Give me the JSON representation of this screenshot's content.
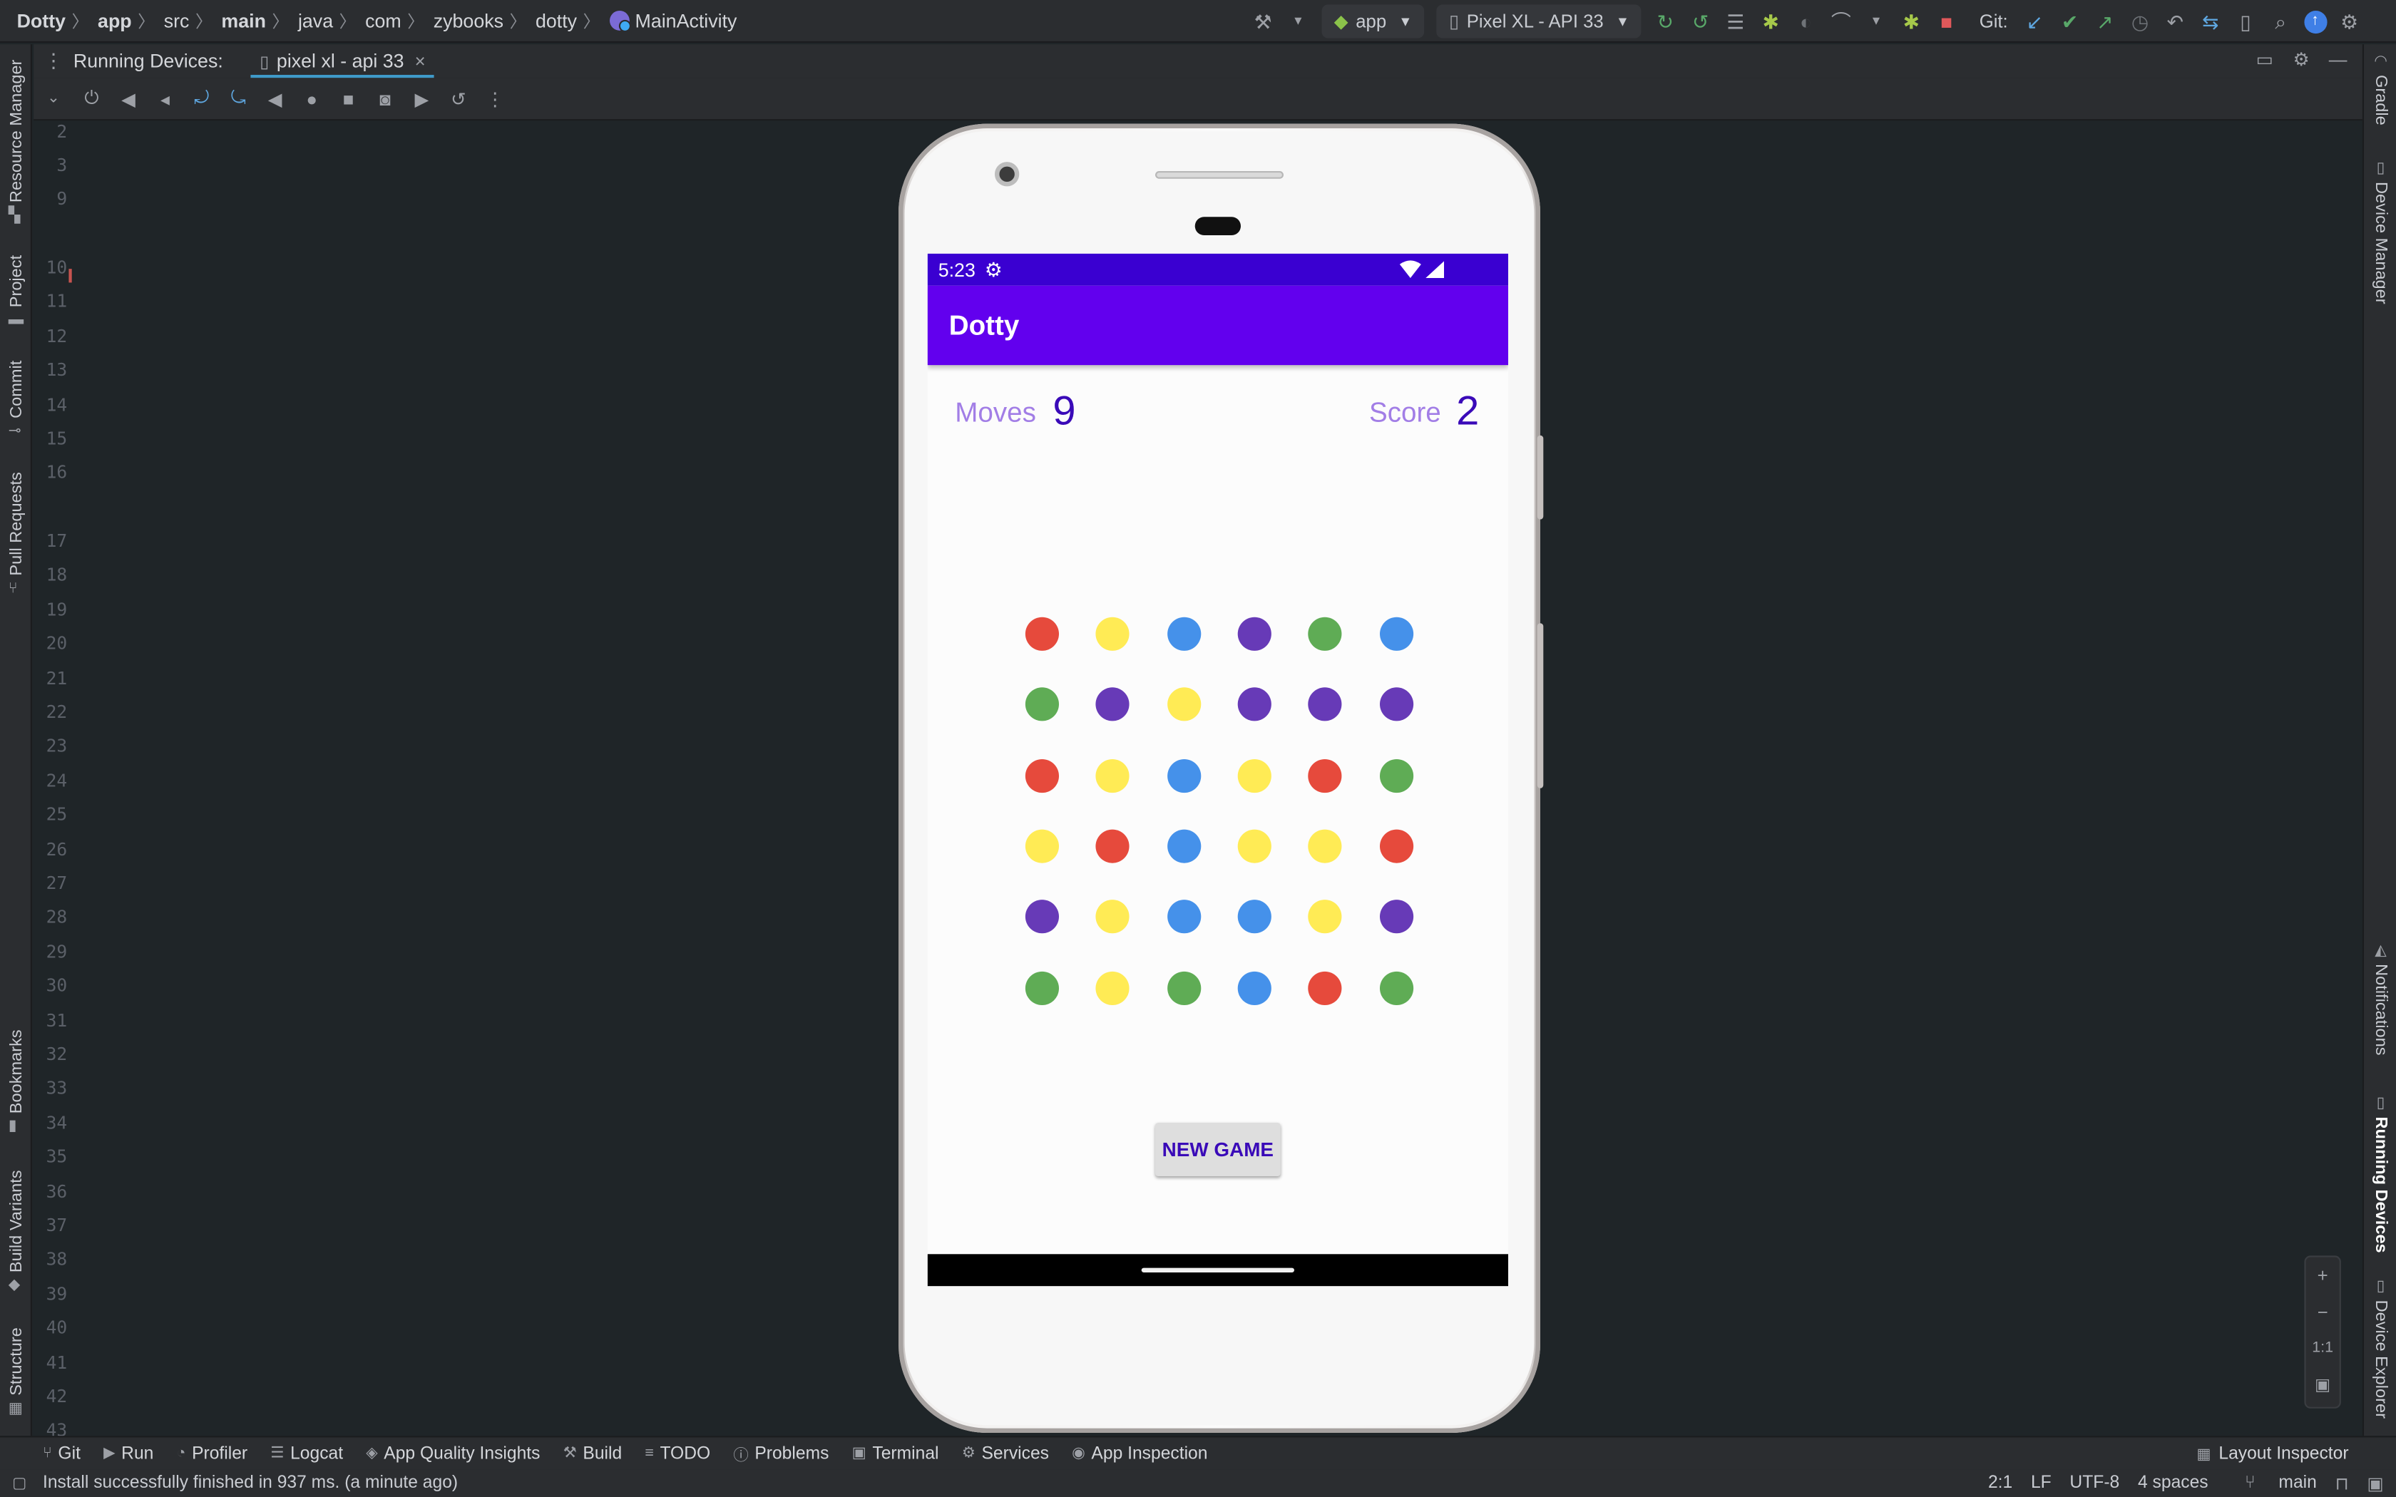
{
  "breadcrumbs": [
    {
      "label": "Dotty",
      "bold": true
    },
    {
      "label": "app",
      "bold": true
    },
    {
      "label": "src",
      "bold": false
    },
    {
      "label": "main",
      "bold": true
    },
    {
      "label": "java",
      "bold": false
    },
    {
      "label": "com",
      "bold": false
    },
    {
      "label": "zybooks",
      "bold": false
    },
    {
      "label": "dotty",
      "bold": false
    }
  ],
  "breadcrumb_class": "MainActivity",
  "toolbar": {
    "run_config": "app",
    "device": "Pixel XL - API 33",
    "git_label": "Git:"
  },
  "left_tabs": {
    "resource_manager": "Resource Manager",
    "project": "Project",
    "commit": "Commit",
    "pull_requests": "Pull Requests",
    "bookmarks": "Bookmarks",
    "build_variants": "Build Variants",
    "structure": "Structure"
  },
  "right_tabs": {
    "gradle": "Gradle",
    "device_manager": "Device Manager",
    "notifications": "Notifications",
    "running_devices": "Running Devices",
    "device_explorer": "Device Explorer"
  },
  "panel": {
    "title": "Running Devices:",
    "device_tab": "pixel xl - api 33"
  },
  "line_numbers": [
    "2",
    "3",
    "9",
    "10",
    "11",
    "12",
    "13",
    "14",
    "15",
    "16",
    "17",
    "18",
    "19",
    "20",
    "21",
    "22",
    "23",
    "24",
    "25",
    "26",
    "27",
    "28",
    "29",
    "30",
    "31",
    "32",
    "33",
    "34",
    "35",
    "36",
    "37",
    "38",
    "39",
    "40",
    "41",
    "42",
    "43"
  ],
  "device_screen": {
    "time": "5:23",
    "app_title": "Dotty",
    "moves_label": "Moves",
    "moves_value": "9",
    "score_label": "Score",
    "score_value": "2",
    "new_game_label": "NEW GAME",
    "colors": {
      "red": "#e64a3c",
      "yellow": "#ffeb55",
      "blue": "#4591ea",
      "purple": "#673ab7",
      "green": "#5fac55"
    },
    "dot_grid": [
      [
        "red",
        "yellow",
        "blue",
        "purple",
        "green",
        "blue"
      ],
      [
        "green",
        "purple",
        "yellow",
        "purple",
        "purple",
        "purple"
      ],
      [
        "red",
        "yellow",
        "blue",
        "yellow",
        "red",
        "green"
      ],
      [
        "yellow",
        "red",
        "blue",
        "yellow",
        "yellow",
        "red"
      ],
      [
        "purple",
        "yellow",
        "blue",
        "blue",
        "yellow",
        "purple"
      ],
      [
        "green",
        "yellow",
        "green",
        "blue",
        "red",
        "green"
      ]
    ]
  },
  "zoom_controls": {
    "plus": "+",
    "minus": "−",
    "one_to_one": "1:1"
  },
  "bottom_tabs": [
    "Git",
    "Run",
    "Profiler",
    "Logcat",
    "App Quality Insights",
    "Build",
    "TODO",
    "Problems",
    "Terminal",
    "Services",
    "App Inspection"
  ],
  "layout_inspector": "Layout Inspector",
  "status": {
    "message": "Install successfully finished in 937 ms. (a minute ago)",
    "position": "2:1",
    "line_sep": "LF",
    "encoding": "UTF-8",
    "indent": "4 spaces",
    "branch": "main"
  }
}
